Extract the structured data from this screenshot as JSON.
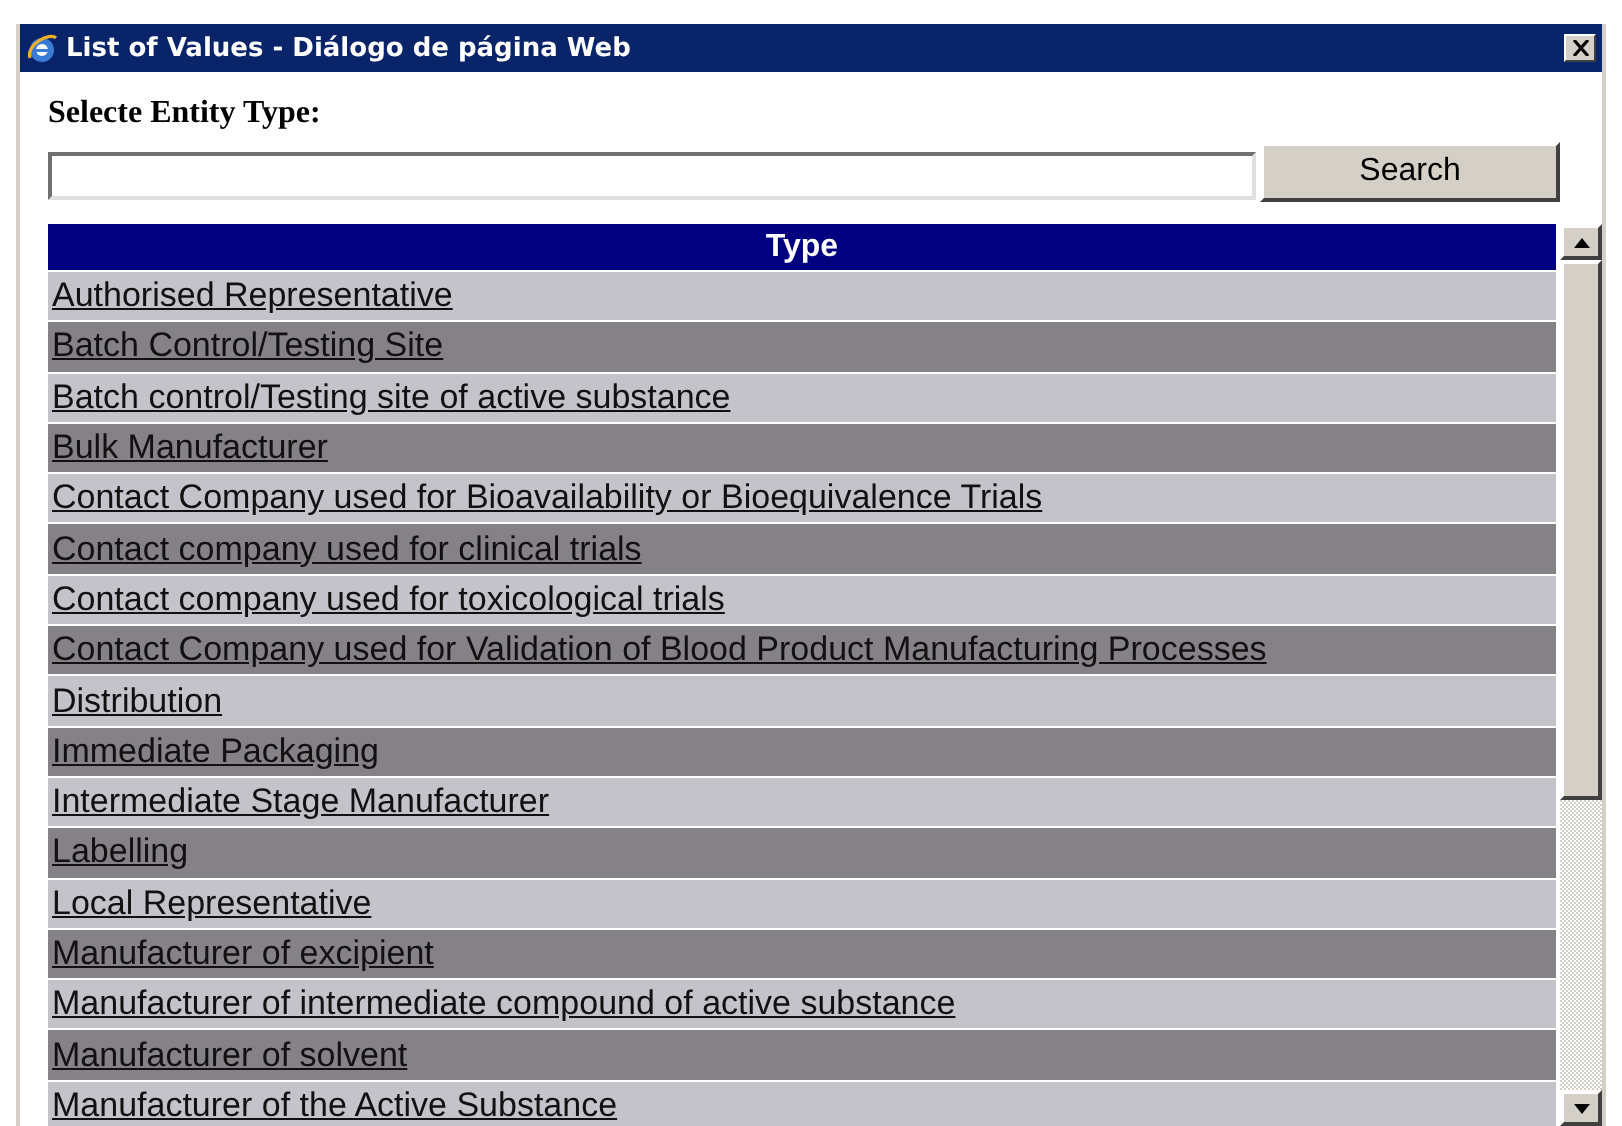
{
  "window": {
    "title": "List of Values - Diálogo de página Web"
  },
  "label": "Selecte Entity Type:",
  "search": {
    "button": "Search"
  },
  "table": {
    "columns": [
      "Type"
    ],
    "rows": [
      "Authorised Representative",
      "Batch Control/Testing Site",
      "Batch control/Testing site of active substance",
      "Bulk Manufacturer",
      "Contact Company used for Bioavailability or Bioequivalence Trials",
      "Contact company used for clinical trials",
      "Contact company used for toxicological trials",
      "Contact Company used for Validation of Blood Product Manufacturing Processes",
      "Distribution",
      "Immediate Packaging",
      "Intermediate Stage Manufacturer",
      "Labelling",
      "Local Representative",
      "Manufacturer of excipient",
      "Manufacturer of intermediate compound of active substance",
      "Manufacturer of solvent",
      "Manufacturer of the Active Substance"
    ]
  }
}
